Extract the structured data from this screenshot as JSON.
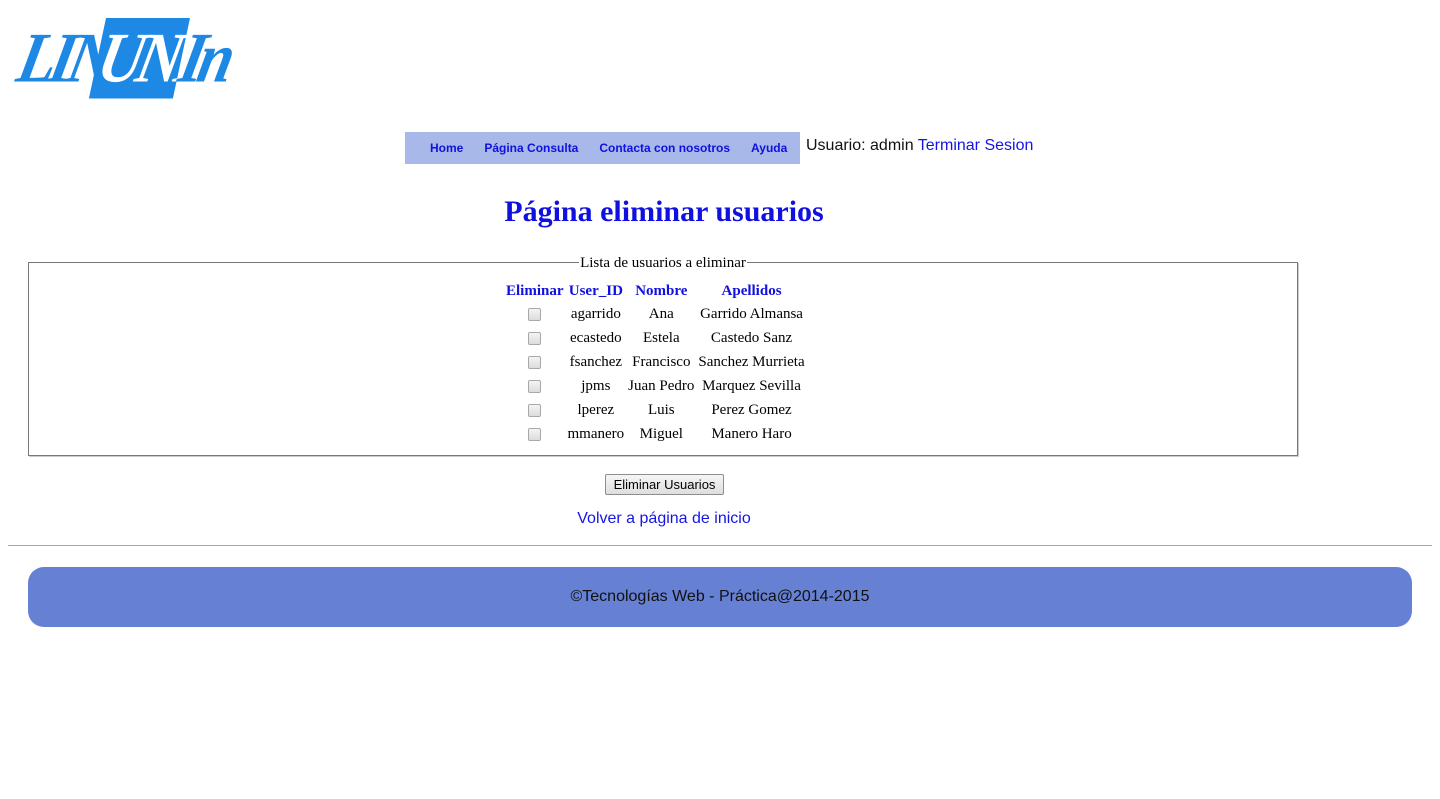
{
  "logo": {
    "part1": "LINK",
    "part2": "UNED",
    "part3": "In"
  },
  "nav": {
    "items": [
      "Home",
      "Página Consulta",
      "Contacta con nosotros",
      "Ayuda"
    ]
  },
  "user": {
    "label": "Usuario: admin",
    "logout": "Terminar Sesion"
  },
  "title": "Página eliminar usuarios",
  "fieldset": {
    "legend": "Lista de usuarios a eliminar"
  },
  "table": {
    "headers": [
      "Eliminar",
      "User_ID",
      "Nombre",
      "Apellidos"
    ],
    "rows": [
      {
        "user_id": "agarrido",
        "nombre": "Ana",
        "apellidos": "Garrido Almansa",
        "checked": false
      },
      {
        "user_id": "ecastedo",
        "nombre": "Estela",
        "apellidos": "Castedo Sanz",
        "checked": false
      },
      {
        "user_id": "fsanchez",
        "nombre": "Francisco",
        "apellidos": "Sanchez Murrieta",
        "checked": false
      },
      {
        "user_id": "jpms",
        "nombre": "Juan Pedro",
        "apellidos": "Marquez Sevilla",
        "checked": false
      },
      {
        "user_id": "lperez",
        "nombre": "Luis",
        "apellidos": "Perez Gomez",
        "checked": false
      },
      {
        "user_id": "mmanero",
        "nombre": "Miguel",
        "apellidos": "Manero Haro",
        "checked": false
      }
    ]
  },
  "button": "Eliminar Usuarios",
  "back_link": "Volver a página de inicio",
  "footer": "©Tecnologías Web - Práctica@2014-2015",
  "colors": {
    "nav_bg": "#a8b8e8",
    "footer_bg": "#6680d3",
    "link": "#1515e6",
    "title": "#1010e0",
    "logo": "#1e88e5"
  }
}
